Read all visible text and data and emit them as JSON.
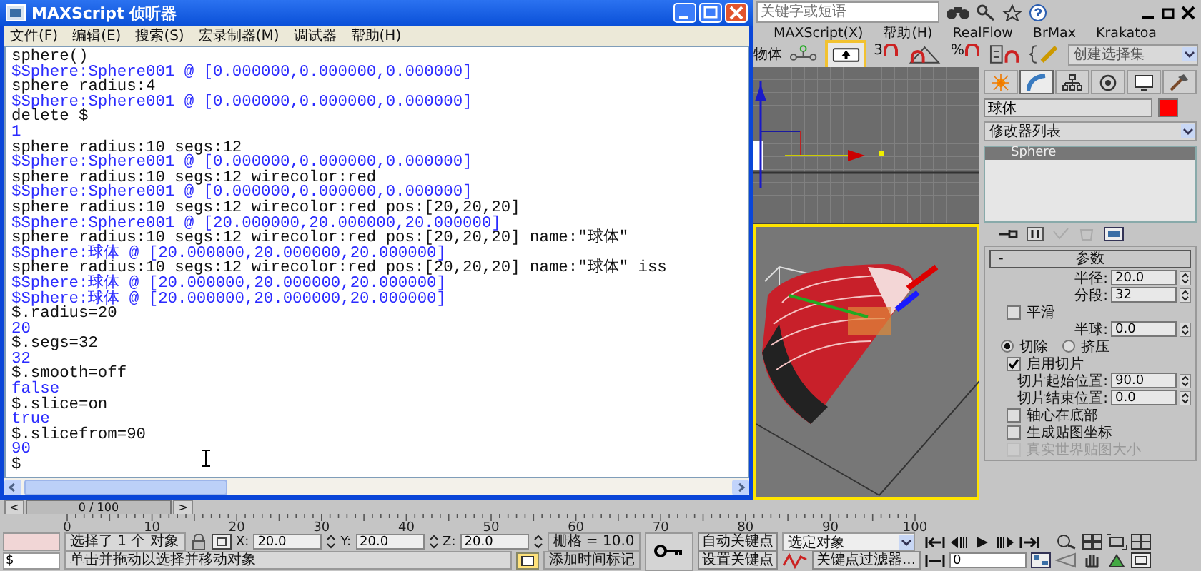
{
  "listener": {
    "title": "MAXScript 侦听器",
    "menu": [
      "文件(F)",
      "编辑(E)",
      "搜索(S)",
      "宏录制器(M)",
      "调试器",
      "帮助(H)"
    ],
    "lines": [
      {
        "kind": "input",
        "text": "sphere()"
      },
      {
        "kind": "output",
        "text": "$Sphere:Sphere001 @ [0.000000,0.000000,0.000000]"
      },
      {
        "kind": "input",
        "text": "sphere radius:4"
      },
      {
        "kind": "output",
        "text": "$Sphere:Sphere001 @ [0.000000,0.000000,0.000000]"
      },
      {
        "kind": "input",
        "text": "delete $"
      },
      {
        "kind": "output",
        "text": "1"
      },
      {
        "kind": "input",
        "text": "sphere radius:10 segs:12"
      },
      {
        "kind": "output",
        "text": "$Sphere:Sphere001 @ [0.000000,0.000000,0.000000]"
      },
      {
        "kind": "input",
        "text": "sphere radius:10 segs:12 wirecolor:red"
      },
      {
        "kind": "output",
        "text": "$Sphere:Sphere001 @ [0.000000,0.000000,0.000000]"
      },
      {
        "kind": "input",
        "text": "sphere radius:10 segs:12 wirecolor:red pos:[20,20,20]"
      },
      {
        "kind": "output",
        "text": "$Sphere:Sphere001 @ [20.000000,20.000000,20.000000]"
      },
      {
        "kind": "input",
        "text": "sphere radius:10 segs:12 wirecolor:red pos:[20,20,20] name:\"球体\""
      },
      {
        "kind": "output",
        "text": "$Sphere:球体 @ [20.000000,20.000000,20.000000]"
      },
      {
        "kind": "input",
        "text": "sphere radius:10 segs:12 wirecolor:red pos:[20,20,20] name:\"球体\" iss"
      },
      {
        "kind": "output",
        "text": "$Sphere:球体 @ [20.000000,20.000000,20.000000]"
      },
      {
        "kind": "output",
        "text": "$Sphere:球体 @ [20.000000,20.000000,20.000000]"
      },
      {
        "kind": "input",
        "text": "$.radius=20"
      },
      {
        "kind": "output",
        "text": "20"
      },
      {
        "kind": "input",
        "text": "$.segs=32"
      },
      {
        "kind": "output",
        "text": "32"
      },
      {
        "kind": "input",
        "text": "$.smooth=off"
      },
      {
        "kind": "output",
        "text": "false"
      },
      {
        "kind": "input",
        "text": "$.slice=on"
      },
      {
        "kind": "output",
        "text": "true"
      },
      {
        "kind": "input",
        "text": "$.slicefrom=90"
      },
      {
        "kind": "output",
        "text": "90"
      },
      {
        "kind": "input",
        "text": "$"
      }
    ]
  },
  "search": {
    "placeholder": "关键字或短语"
  },
  "menu": [
    "MAXScript(X)",
    "帮助(H)",
    "RealFlow",
    "BrMax",
    "Krakatoa"
  ],
  "toolbar": [
    {
      "kind": "text",
      "label": "物体"
    },
    {
      "kind": "pivot",
      "active": false
    },
    {
      "kind": "move",
      "active": true
    },
    {
      "kind": "snap",
      "label": "3",
      "active": false
    },
    {
      "kind": "angle",
      "active": false
    },
    {
      "kind": "snap",
      "label": "%",
      "active": false
    },
    {
      "kind": "spinsnap",
      "active": false
    },
    {
      "kind": "sets",
      "active": false
    },
    {
      "kind": "dropdown",
      "label": "创建选择集"
    }
  ],
  "command_panel": {
    "tabs": [
      {
        "kind": "create",
        "selected": false
      },
      {
        "kind": "modify",
        "selected": true
      },
      {
        "kind": "hierarchy",
        "selected": false
      },
      {
        "kind": "motion",
        "selected": false
      },
      {
        "kind": "display",
        "selected": false
      },
      {
        "kind": "utilities",
        "selected": false
      }
    ],
    "object_name": "球体",
    "modifier_list": "修改器列表",
    "stack": [
      {
        "label": "Sphere",
        "selected": true
      }
    ],
    "rollout": {
      "title": "参数",
      "toggle": "-",
      "rows": [
        {
          "kind": "spinner",
          "label": "半径:",
          "value": "20.0"
        },
        {
          "kind": "spinner",
          "label": "分段:",
          "value": "32"
        },
        {
          "kind": "checkbox",
          "label": "平滑",
          "checked": false,
          "disabled": false
        },
        {
          "kind": "spinner",
          "label": "半球:",
          "value": "0.0"
        },
        {
          "kind": "radio",
          "options": [
            {
              "label": "切除",
              "selected": true
            },
            {
              "label": "挤压",
              "selected": false
            }
          ]
        },
        {
          "kind": "checkbox",
          "label": "启用切片",
          "checked": true,
          "disabled": false
        },
        {
          "kind": "spinner",
          "label": "切片起始位置:",
          "value": "90.0"
        },
        {
          "kind": "spinner",
          "label": "切片结束位置:",
          "value": "0.0"
        },
        {
          "kind": "checkbox",
          "label": "轴心在底部",
          "checked": false,
          "disabled": false
        },
        {
          "kind": "checkbox",
          "label": "生成贴图坐标",
          "checked": false,
          "disabled": false
        },
        {
          "kind": "checkbox",
          "label": "真实世界贴图大小",
          "checked": false,
          "disabled": true
        }
      ]
    }
  },
  "time_slider": {
    "prev": "<",
    "position": "0 / 100",
    "next": ">"
  },
  "ruler": [
    "0",
    "10",
    "20",
    "30",
    "40",
    "50",
    "60",
    "70",
    "80",
    "90",
    "100"
  ],
  "status": {
    "selection": "选择了 1 个 对象",
    "coords": [
      {
        "label": "X:",
        "value": "20.0"
      },
      {
        "label": "Y:",
        "value": "20.0"
      },
      {
        "label": "Z:",
        "value": "20.0"
      }
    ],
    "grid": "栅格 = 10.0",
    "mini_listener": "$",
    "prompt": "单击并拖动以选择并移动对象",
    "time_tag": "添加时间标记",
    "auto_key": "自动关键点",
    "set_key": "设置关键点",
    "key_target": "选定对象",
    "key_filters": "关键点过滤器...",
    "frame": "0"
  }
}
